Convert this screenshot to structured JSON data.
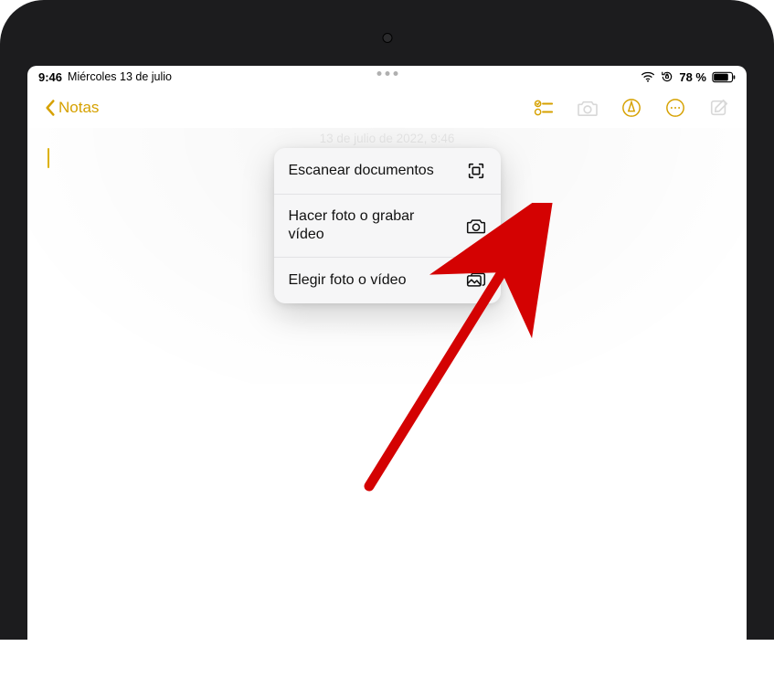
{
  "statusbar": {
    "time": "9:46",
    "date": "Miércoles 13 de julio",
    "battery_text": "78 %"
  },
  "nav": {
    "back_label": "Notas"
  },
  "note": {
    "ghost_date": "13 de julio de 2022, 9:46"
  },
  "menu": {
    "scan_label": "Escanear documentos",
    "take_label": "Hacer foto o grabar vídeo",
    "choose_label": "Elegir foto o vídeo"
  },
  "colors": {
    "accent": "#d6a100",
    "arrow": "#d40202"
  }
}
